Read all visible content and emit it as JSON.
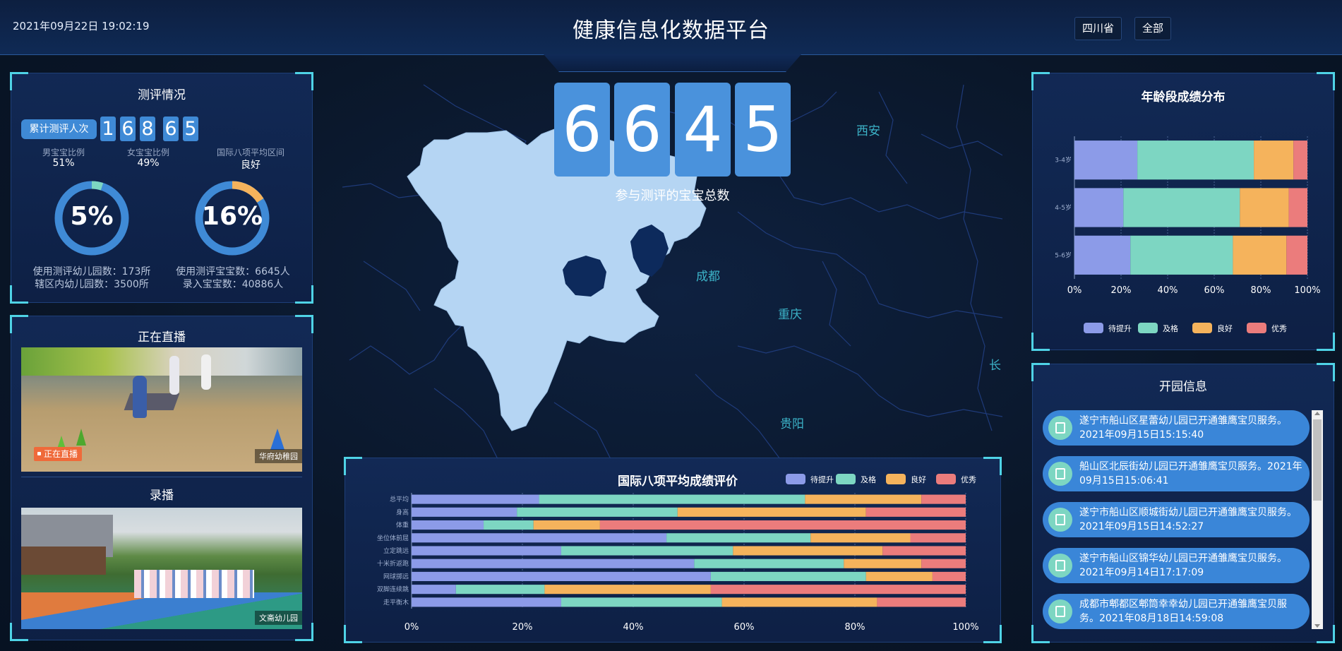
{
  "header": {
    "datetime": "2021年09月22日 19:02:19",
    "title": "健康信息化数据平台",
    "province_btn": "四川省",
    "all_btn": "全部"
  },
  "assessment": {
    "title": "测评情况",
    "total_label": "累计测评人次",
    "total_digits": [
      "1",
      "6",
      "8",
      "6",
      "5"
    ],
    "boy_label": "男宝宝比例",
    "boy_value": "51%",
    "girl_label": "女宝宝比例",
    "girl_value": "49%",
    "intl_label": "国际八项平均区间",
    "intl_value": "良好",
    "ring1": {
      "text": "5%",
      "fraction": 0.05,
      "color": "#7dd6c2"
    },
    "ring2": {
      "text": "16%",
      "fraction": 0.16,
      "color": "#f5b35c"
    },
    "kg_used": "使用测评幼儿园数：173所",
    "kg_total": "辖区内幼儿园数：3500所",
    "baby_used": "使用测评宝宝数：6645人",
    "baby_total": "录入宝宝数：40886人"
  },
  "live": {
    "title": "正在直播",
    "badge": "正在直播",
    "place": "华府幼稚园"
  },
  "record": {
    "title": "录播",
    "place": "文斋幼儿园"
  },
  "map": {
    "total_digits": [
      "6",
      "6",
      "4",
      "5"
    ],
    "total_label": "参与测评的宝宝总数",
    "cities": {
      "xian": "西安",
      "chengdu": "成都",
      "chongqing": "重庆",
      "guiyang": "贵阳",
      "chang": "长"
    }
  },
  "age_chart": {
    "title": "年龄段成绩分布"
  },
  "bottom_chart": {
    "title": "国际八项平均成绩评价"
  },
  "news": {
    "title": "开园信息",
    "items": [
      "遂宁市船山区星蕾幼儿园已开通雏鹰宝贝服务。2021年09月15日15:15:40",
      "船山区北辰街幼儿园已开通雏鹰宝贝服务。2021年09月15日15:06:41",
      "遂宁市船山区顺城街幼儿园已开通雏鹰宝贝服务。2021年09月15日14:52:27",
      "遂宁市船山区锦华幼儿园已开通雏鹰宝贝服务。2021年09月14日17:17:09",
      "成都市郫都区郫筒幸幸幼儿园已开通雏鹰宝贝服务。2021年08月18日14:59:08"
    ]
  },
  "chart_data": [
    {
      "type": "bar",
      "orientation": "horizontal",
      "stacked": true,
      "title": "年龄段成绩分布",
      "categories": [
        "3-4岁",
        "4-5岁",
        "5-6岁"
      ],
      "series": [
        {
          "name": "待提升",
          "color": "#8c9be8",
          "values": [
            27,
            21,
            24
          ]
        },
        {
          "name": "及格",
          "color": "#7dd6c2",
          "values": [
            50,
            50,
            44
          ]
        },
        {
          "name": "良好",
          "color": "#f5b35c",
          "values": [
            17,
            21,
            23
          ]
        },
        {
          "name": "优秀",
          "color": "#eb7c7c",
          "values": [
            6,
            8,
            9
          ]
        }
      ],
      "xlim": [
        0,
        100
      ],
      "x_ticks": [
        "0%",
        "20%",
        "40%",
        "60%",
        "80%",
        "100%"
      ],
      "legend": "bottom"
    },
    {
      "type": "bar",
      "orientation": "horizontal",
      "stacked": true,
      "title": "国际八项平均成绩评价",
      "categories": [
        "总平均",
        "身高",
        "体重",
        "坐位体前屈",
        "立定跳远",
        "十米折返跑",
        "网球掷远",
        "双脚连续跳",
        "走平衡木"
      ],
      "series": [
        {
          "name": "待提升",
          "color": "#8c9be8",
          "values": [
            23,
            19,
            13,
            46,
            27,
            51,
            54,
            8,
            27
          ]
        },
        {
          "name": "及格",
          "color": "#7dd6c2",
          "values": [
            48,
            29,
            9,
            26,
            31,
            27,
            28,
            16,
            29
          ]
        },
        {
          "name": "良好",
          "color": "#f5b35c",
          "values": [
            21,
            34,
            12,
            18,
            27,
            14,
            12,
            30,
            28
          ]
        },
        {
          "name": "优秀",
          "color": "#eb7c7c",
          "values": [
            8,
            18,
            66,
            10,
            15,
            8,
            6,
            46,
            16
          ]
        }
      ],
      "xlim": [
        0,
        100
      ],
      "x_ticks": [
        "0%",
        "20%",
        "40%",
        "60%",
        "80%",
        "100%"
      ],
      "legend": "top-right"
    }
  ]
}
